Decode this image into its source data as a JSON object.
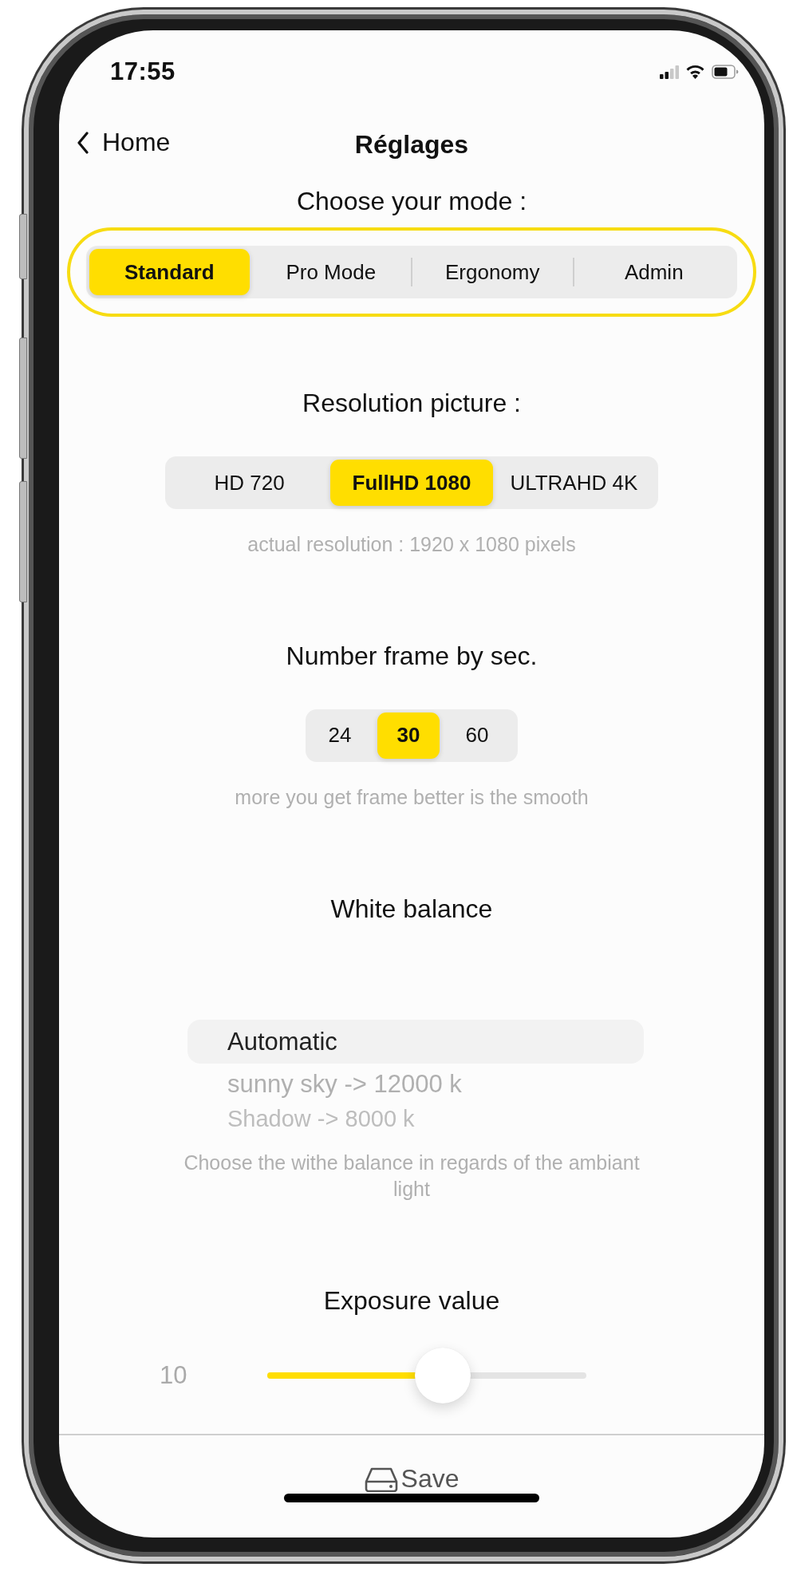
{
  "status_bar": {
    "time": "17:55"
  },
  "nav": {
    "back": "Home",
    "title": "Réglages"
  },
  "mode": {
    "title": "Choose your mode :",
    "highlighted": true,
    "options": [
      {
        "label": "Standard",
        "selected": true
      },
      {
        "label": "Pro Mode",
        "selected": false
      },
      {
        "label": "Ergonomy",
        "selected": false
      },
      {
        "label": "Admin",
        "selected": false
      }
    ]
  },
  "resolution": {
    "title": "Resolution picture :",
    "options": [
      {
        "label": "HD 720",
        "selected": false
      },
      {
        "label": "FullHD 1080",
        "selected": true
      },
      {
        "label": "ULTRAHD 4K",
        "selected": false
      }
    ],
    "caption": "actual resolution : 1920 x 1080 pixels"
  },
  "frame_rate": {
    "title": "Number frame by sec.",
    "options": [
      {
        "label": "24",
        "selected": false
      },
      {
        "label": "30",
        "selected": true
      },
      {
        "label": "60",
        "selected": false
      }
    ],
    "caption": "more you get frame better is the smooth"
  },
  "white_balance": {
    "title": "White balance",
    "options": [
      {
        "label": "Automatic",
        "selected": true
      },
      {
        "label": "sunny sky -> 12000 k",
        "selected": false
      },
      {
        "label": "Shadow -> 8000 k",
        "selected": false
      }
    ],
    "caption": "Choose the withe balance in regards of the ambiant light"
  },
  "exposure": {
    "title": "Exposure value",
    "reading": "10",
    "level": 0.55
  },
  "save": {
    "label": "Save"
  }
}
